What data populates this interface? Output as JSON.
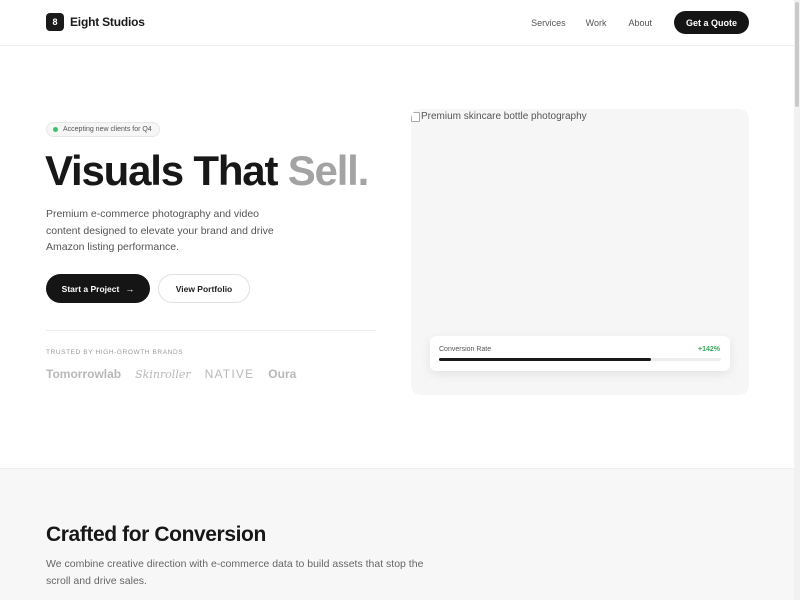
{
  "header": {
    "logo_mark": "8",
    "brand": "Eight Studios",
    "nav": [
      "Services",
      "Work",
      "About"
    ],
    "cta": "Get a Quote"
  },
  "hero": {
    "badge": "Accepting new clients for Q4",
    "title_main": "Visuals That ",
    "title_accent": "Sell.",
    "description": "Premium e-commerce photography and video content designed to elevate your brand and drive Amazon listing performance.",
    "primary_button": "Start a Project",
    "primary_arrow": "→",
    "secondary_button": "View Portfolio",
    "trusted_label": "TRUSTED BY HIGH-GROWTH BRANDS",
    "brands": [
      "Tomorrowlab",
      "Skinroller",
      "NATIVE",
      "Oura"
    ]
  },
  "media": {
    "image_alt": "Premium skincare bottle photography",
    "metric_label": "Conversion Rate",
    "metric_value": "+142%",
    "metric_progress": 0.75
  },
  "section2": {
    "title": "Crafted for Conversion",
    "description": "We combine creative direction with e-commerce data to build assets that stop the scroll and drive sales."
  },
  "colors": {
    "primary": "#151515",
    "accent_green": "#3cc26c",
    "muted_text": "#a3a3a3"
  }
}
